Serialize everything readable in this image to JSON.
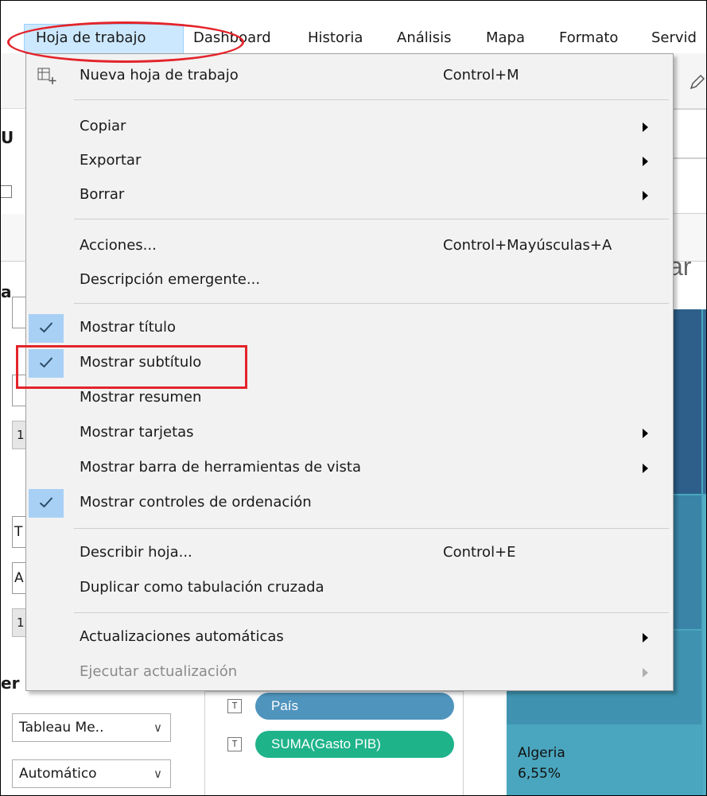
{
  "menubar": {
    "items": [
      {
        "label": "Hoja de trabajo"
      },
      {
        "label": "Dashboard"
      },
      {
        "label": "Historia"
      },
      {
        "label": "Análisis"
      },
      {
        "label": "Mapa"
      },
      {
        "label": "Formato"
      },
      {
        "label": "Servid"
      }
    ]
  },
  "menu": {
    "new_sheet": {
      "label": "Nueva hoja de trabajo",
      "shortcut": "Control+M"
    },
    "copy": {
      "label": "Copiar"
    },
    "export": {
      "label": "Exportar"
    },
    "clear": {
      "label": "Borrar"
    },
    "actions": {
      "label": "Acciones...",
      "shortcut": "Control+Mayúsculas+A"
    },
    "tooltip": {
      "label": "Descripción emergente..."
    },
    "show_title": {
      "label": "Mostrar título",
      "checked": true
    },
    "show_subtitle": {
      "label": "Mostrar subtítulo",
      "checked": true
    },
    "show_summary": {
      "label": "Mostrar resumen",
      "checked": false
    },
    "show_cards": {
      "label": "Mostrar tarjetas"
    },
    "show_view_toolbar": {
      "label": "Mostrar barra de herramientas de vista"
    },
    "show_sort_controls": {
      "label": "Mostrar controles de ordenación",
      "checked": true
    },
    "describe_sheet": {
      "label": "Describir hoja...",
      "shortcut": "Control+E"
    },
    "duplicate_crosstab": {
      "label": "Duplicar como tabulación cruzada"
    },
    "auto_updates": {
      "label": "Actualizaciones automáticas"
    },
    "run_update": {
      "label": "Ejecutar actualización",
      "disabled": true
    }
  },
  "background": {
    "partial_ar": "ar",
    "left_frag_u": "U",
    "left_frag_a": "a",
    "left_frag_one": "1",
    "left_frag_t": "T",
    "left_frag_A": "A",
    "left_frag_er": "er",
    "pill_country": "País",
    "pill_measure": "SUMA(Gasto PIB)",
    "pill_tag": "T",
    "dropdown_font": "Tableau Me..",
    "dropdown_auto": "Automático",
    "treemap_label": "Algeria",
    "treemap_value": "6,55%"
  },
  "colors": {
    "treemap_dark": "#2d5f8a",
    "treemap_mid": "#3a84a8",
    "treemap_light": "#4aa6be",
    "pill_blue": "#4f94bd",
    "pill_green": "#1fb38a",
    "check_bg": "#a8d0f5",
    "annotation_red": "#e3242b"
  }
}
